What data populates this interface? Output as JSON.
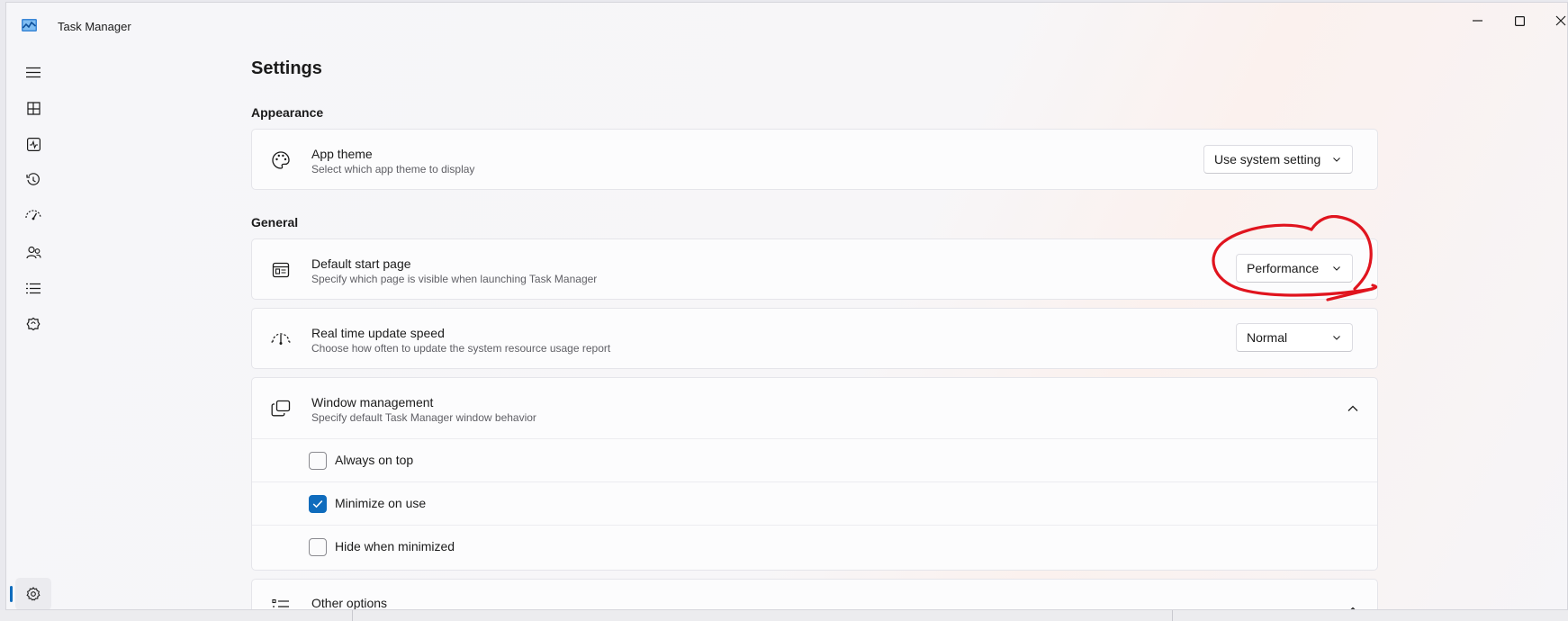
{
  "window": {
    "title": "Task Manager"
  },
  "page": {
    "title": "Settings"
  },
  "sections": {
    "appearance": "Appearance",
    "general": "General"
  },
  "app_theme": {
    "title": "App theme",
    "subtitle": "Select which app theme to display",
    "value": "Use system setting"
  },
  "default_start_page": {
    "title": "Default start page",
    "subtitle": "Specify which page is visible when launching Task Manager",
    "value": "Performance"
  },
  "update_speed": {
    "title": "Real time update speed",
    "subtitle": "Choose how often to update the system resource usage report",
    "value": "Normal"
  },
  "window_management": {
    "title": "Window management",
    "subtitle": "Specify default Task Manager window behavior",
    "options": [
      {
        "label": "Always on top",
        "checked": false
      },
      {
        "label": "Minimize on use",
        "checked": true
      },
      {
        "label": "Hide when minimized",
        "checked": false
      }
    ]
  },
  "other_options": {
    "title": "Other options"
  },
  "colors": {
    "accent": "#0f6cbd",
    "annotation": "#e0141e"
  },
  "icons": {
    "rail": [
      "hamburger-icon",
      "processes-icon",
      "performance-icon",
      "app-history-icon",
      "startup-apps-icon",
      "users-icon",
      "details-icon",
      "services-icon",
      "settings-icon"
    ]
  }
}
